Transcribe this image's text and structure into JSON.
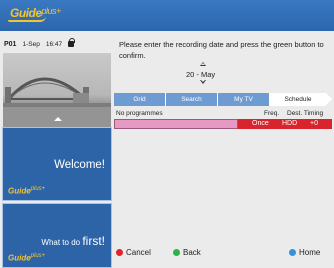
{
  "brand": {
    "logo_text": "Guide",
    "logo_plus": "plus+"
  },
  "status": {
    "channel": "P01",
    "date": "1-Sep",
    "time": "16:47",
    "lock_icon": "lock-icon"
  },
  "tiles": {
    "welcome": {
      "label": "Welcome!"
    },
    "first_steps": {
      "label_prefix": "What to do ",
      "label_emph": "first!"
    }
  },
  "instruction": "Please enter the recording date and press the green button to confirm.",
  "date_selector": {
    "value": "20 - May"
  },
  "tabs": [
    {
      "label": "Grid",
      "active": false
    },
    {
      "label": "Search",
      "active": false
    },
    {
      "label": "My TV",
      "active": false
    },
    {
      "label": "Schedule",
      "active": true
    }
  ],
  "table": {
    "headers": {
      "programmes": "No programmes",
      "freq": "Freq.",
      "dest_timing": "Dest. Timing"
    },
    "row": {
      "freq": "Once",
      "dest": "HDD",
      "timing": "+0"
    }
  },
  "footer": {
    "cancel": {
      "label": "Cancel",
      "color": "#e0242a"
    },
    "back": {
      "label": "Back",
      "color": "#2bb34a"
    },
    "home": {
      "label": "Home",
      "color": "#3a8fdb"
    }
  },
  "colors": {
    "header_blue": "#2b66ad",
    "tab_blue": "#6e9bd2",
    "row_pink": "#e59ac3",
    "row_red": "#d9242e",
    "logo_yellow": "#f4c430"
  }
}
